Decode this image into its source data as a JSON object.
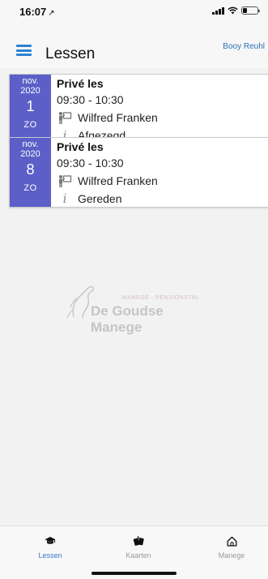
{
  "status_bar": {
    "time": "16:07",
    "location_glyph": "↗"
  },
  "header": {
    "title": "Lessen",
    "user": "Booy Reuhl"
  },
  "lessons": [
    {
      "month": "nov.",
      "year": "2020",
      "day": "1",
      "weekday": "ZO",
      "type": "Privé les",
      "time": "09:30 - 10:30",
      "instructor": "Wilfred Franken",
      "status": "Afgezegd"
    },
    {
      "month": "nov.",
      "year": "2020",
      "day": "8",
      "weekday": "ZO",
      "type": "Privé les",
      "time": "09:30 - 10:30",
      "instructor": "Wilfred Franken",
      "status": "Gereden"
    }
  ],
  "watermark": {
    "tagline": "MANEGE - PENSIONSTAL",
    "name": "De Goudse Manege"
  },
  "tabs": [
    {
      "label": "Lessen",
      "icon": "graduation-cap-icon",
      "active": true
    },
    {
      "label": "Kaarten",
      "icon": "cards-icon",
      "active": false
    },
    {
      "label": "Manege",
      "icon": "home-icon",
      "active": false
    }
  ],
  "colors": {
    "date_block": "#5b5fc7",
    "accent": "#2a82d0",
    "active_tab": "#3a78c2"
  }
}
